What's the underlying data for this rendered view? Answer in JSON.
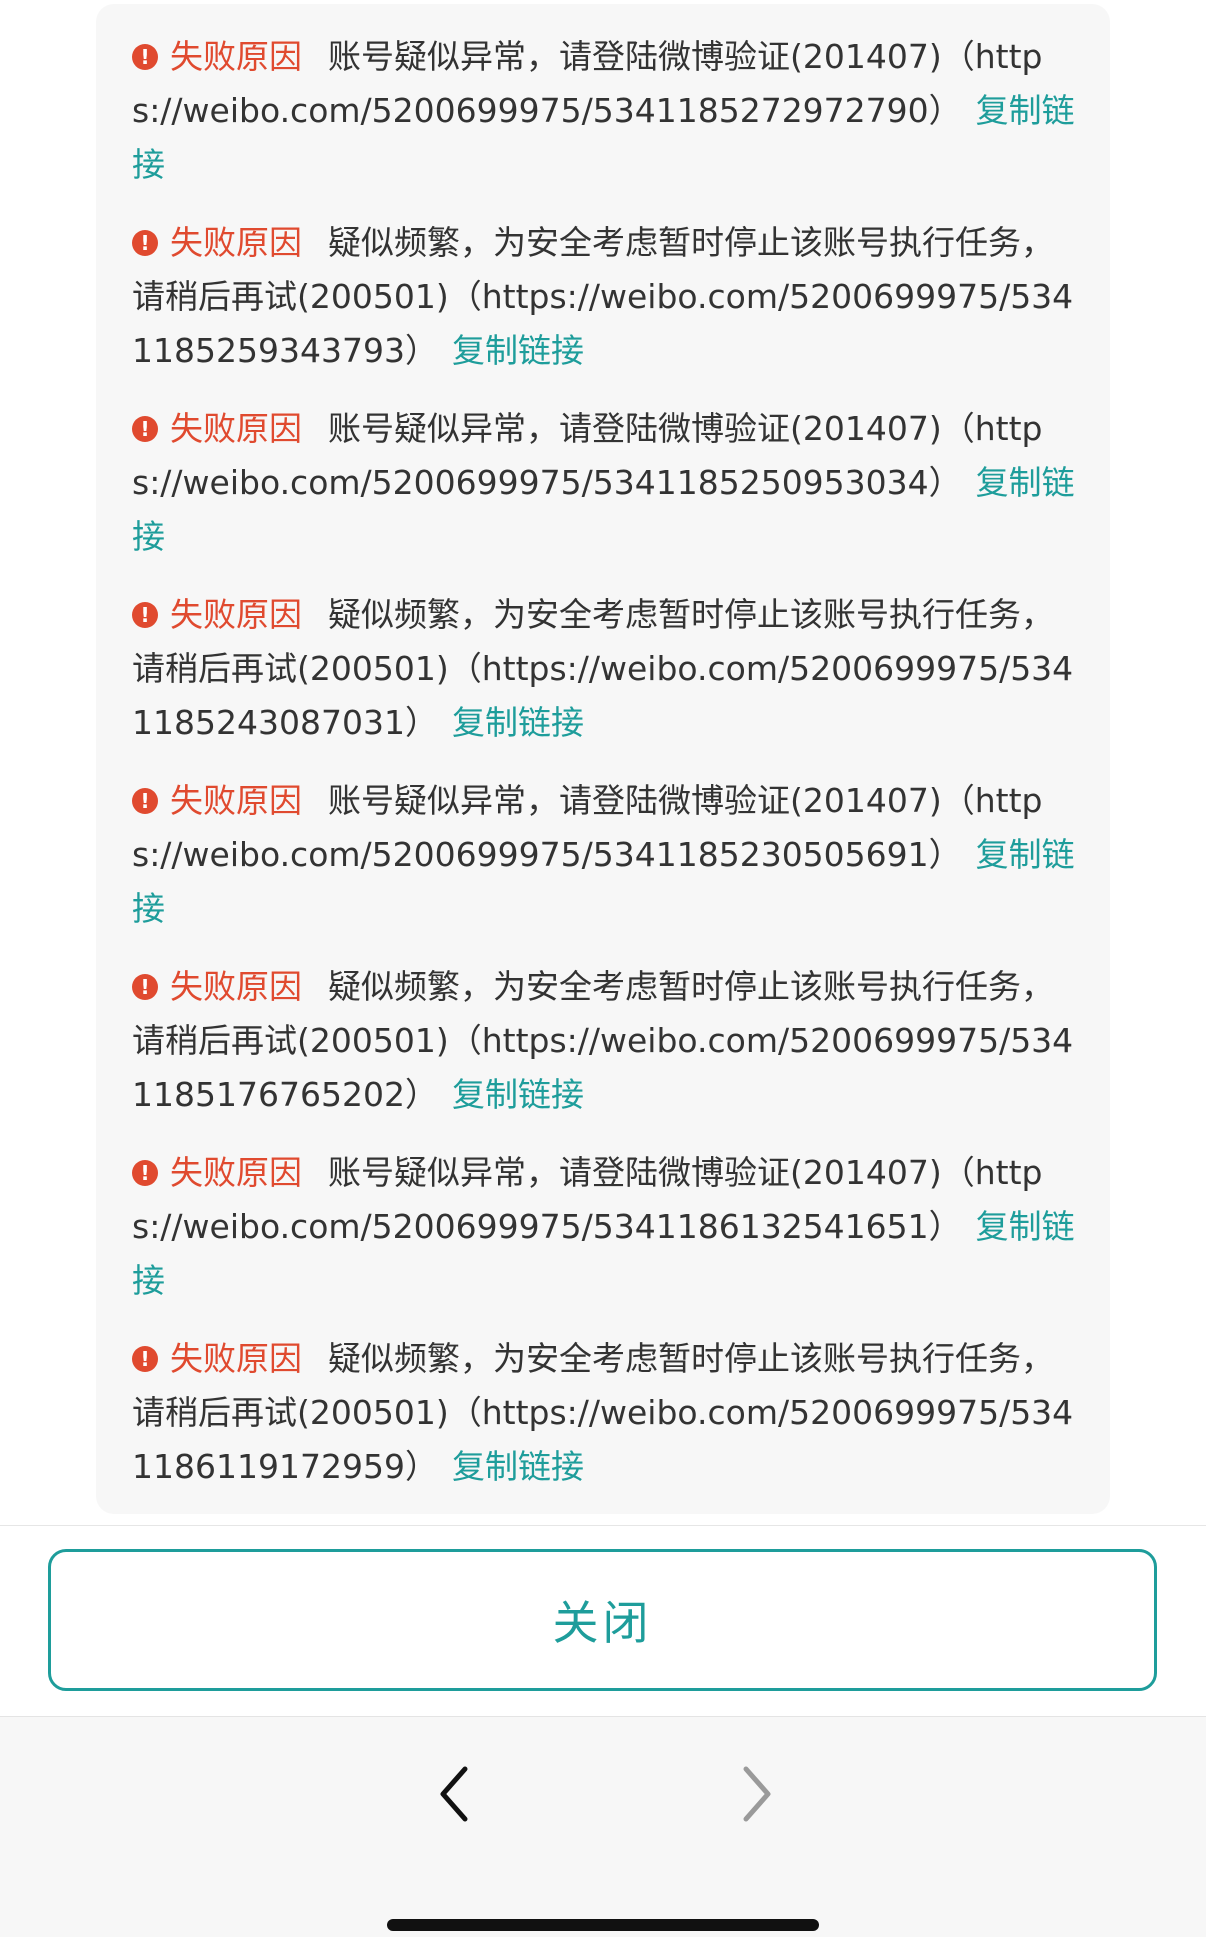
{
  "failure_entries": [
    {
      "label": "失败原因",
      "message": "账号疑似异常，请登陆微博验证(201407)（https://weibo.com/5200699975/5341185272972790）",
      "copy_label": "复制链接"
    },
    {
      "label": "失败原因",
      "message": "疑似频繁，为安全考虑暂时停止该账号执行任务，请稍后再试(200501)（https://weibo.com/5200699975/5341185259343793）",
      "copy_label": "复制链接"
    },
    {
      "label": "失败原因",
      "message": "账号疑似异常，请登陆微博验证(201407)（https://weibo.com/5200699975/5341185250953034）",
      "copy_label": "复制链接"
    },
    {
      "label": "失败原因",
      "message": "疑似频繁，为安全考虑暂时停止该账号执行任务，请稍后再试(200501)（https://weibo.com/5200699975/5341185243087031）",
      "copy_label": "复制链接"
    },
    {
      "label": "失败原因",
      "message": "账号疑似异常，请登陆微博验证(201407)（https://weibo.com/5200699975/5341185230505691）",
      "copy_label": "复制链接"
    },
    {
      "label": "失败原因",
      "message": "疑似频繁，为安全考虑暂时停止该账号执行任务，请稍后再试(200501)（https://weibo.com/5200699975/5341185176765202）",
      "copy_label": "复制链接"
    },
    {
      "label": "失败原因",
      "message": "账号疑似异常，请登陆微博验证(201407)（https://weibo.com/5200699975/5341186132541651）",
      "copy_label": "复制链接"
    },
    {
      "label": "失败原因",
      "message": "疑似频繁，为安全考虑暂时停止该账号执行任务，请稍后再试(200501)（https://weibo.com/5200699975/5341186119172959）",
      "copy_label": "复制链接"
    }
  ],
  "close_button": {
    "label": "关闭"
  },
  "icons": {
    "error": "exclamation-circle-icon",
    "back": "chevron-left-icon",
    "forward": "chevron-right-icon"
  },
  "colors": {
    "error_red": "#e04a2f",
    "accent_teal": "#1e9d9b",
    "text": "#333333",
    "panel_bg": "#f7f7f7"
  }
}
